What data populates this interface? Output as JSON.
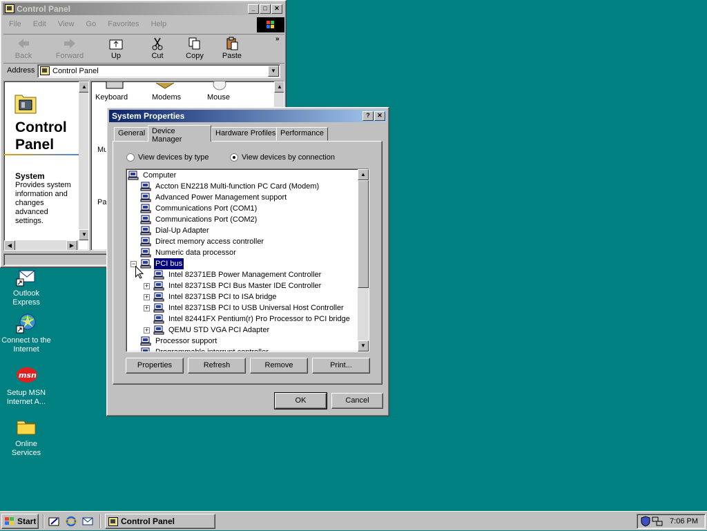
{
  "desktop": {
    "icons": [
      {
        "label": "Outlook Express"
      },
      {
        "label": "Connect to the Internet"
      },
      {
        "label": "Setup MSN Internet A..."
      },
      {
        "label": "Online Services"
      }
    ]
  },
  "control_panel": {
    "title": "Control Panel",
    "menu": [
      "File",
      "Edit",
      "View",
      "Go",
      "Favorites",
      "Help"
    ],
    "toolbar": {
      "back": "Back",
      "forward": "Forward",
      "up": "Up",
      "cut": "Cut",
      "copy": "Copy",
      "paste": "Paste"
    },
    "address_label": "Address",
    "address_value": "Control Panel",
    "side": {
      "heading": "Control Panel",
      "item_title": "System",
      "description": "Provides system information and changes advanced settings."
    },
    "icons": [
      "Keyboard",
      "Modems",
      "Mouse"
    ],
    "partial_labels": {
      "mu": "Mu",
      "pa": "Pa"
    }
  },
  "dialog": {
    "title": "System Properties",
    "tabs": [
      "General",
      "Device Manager",
      "Hardware Profiles",
      "Performance"
    ],
    "radio_by_type": "View devices by type",
    "radio_by_connection": "View devices by connection",
    "tree": [
      {
        "label": "Computer",
        "level": 0
      },
      {
        "label": "Accton EN2218 Multi-function PC Card (Modem)",
        "level": 1
      },
      {
        "label": "Advanced Power Management support",
        "level": 1
      },
      {
        "label": "Communications Port (COM1)",
        "level": 1
      },
      {
        "label": "Communications Port (COM2)",
        "level": 1
      },
      {
        "label": "Dial-Up Adapter",
        "level": 1
      },
      {
        "label": "Direct memory access controller",
        "level": 1
      },
      {
        "label": "Numeric data processor",
        "level": 1
      },
      {
        "label": "PCI bus",
        "level": 1,
        "selected": true
      },
      {
        "label": "Intel 82371EB Power Management Controller",
        "level": 2
      },
      {
        "label": "Intel 82371SB PCI Bus Master IDE Controller",
        "level": 2
      },
      {
        "label": "Intel 82371SB PCI to ISA bridge",
        "level": 2
      },
      {
        "label": "Intel 82371SB PCI to USB Universal Host Controller",
        "level": 2
      },
      {
        "label": "Intel 82441FX Pentium(r) Pro Processor to PCI bridge",
        "level": 2
      },
      {
        "label": "QEMU STD VGA PCI Adapter",
        "level": 2
      },
      {
        "label": "Processor support",
        "level": 1
      },
      {
        "label": "Programmable interrupt controller",
        "level": 1
      }
    ],
    "buttons": {
      "properties": "Properties",
      "refresh": "Refresh",
      "remove": "Remove",
      "print": "Print...",
      "ok": "OK",
      "cancel": "Cancel"
    }
  },
  "taskbar": {
    "start": "Start",
    "task": "Control Panel",
    "clock": "7:06 PM"
  }
}
